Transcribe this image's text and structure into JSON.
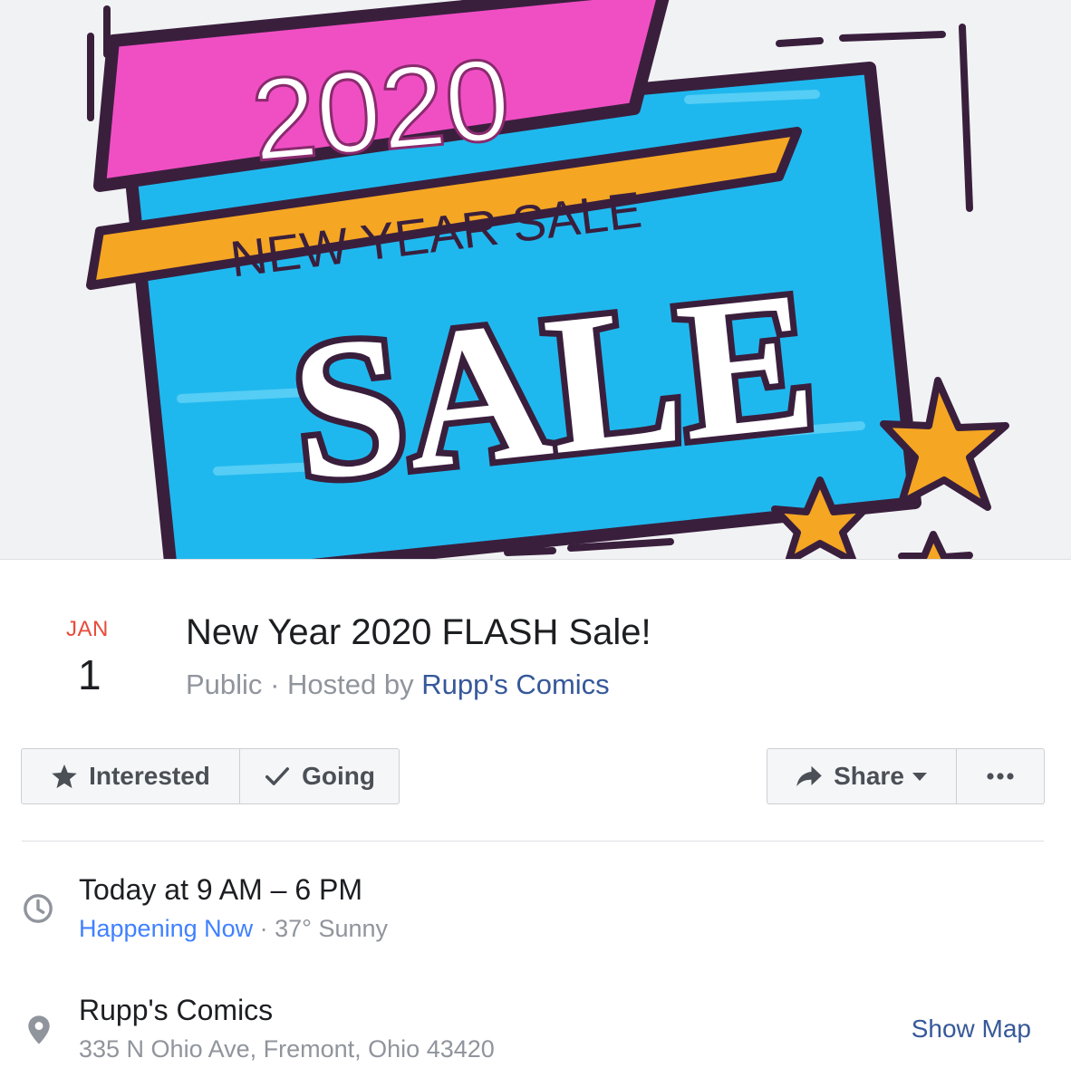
{
  "cover": {
    "year_text": "2020",
    "ribbon_text": "NEW YEAR SALE",
    "sale_text": "SALE",
    "colors": {
      "pink": "#f04fc4",
      "blue": "#1fb8ee",
      "orange": "#f5a623",
      "dark": "#3a1f3d",
      "background": "#f1f2f4"
    }
  },
  "event": {
    "month": "JAN",
    "day": "1",
    "title": "New Year 2020 FLASH Sale!",
    "privacy": "Public",
    "hosted_by_prefix": "Hosted by",
    "host_name": "Rupp's Comics"
  },
  "actions": {
    "interested_label": "Interested",
    "interested_icon": "star-icon",
    "going_label": "Going",
    "going_icon": "check-icon",
    "share_label": "Share",
    "share_icon": "share-arrow-icon",
    "more_icon": "more-dots-icon"
  },
  "details": {
    "time": {
      "icon": "clock-icon",
      "when": "Today at 9 AM – 6 PM",
      "status": "Happening Now",
      "weather": "37° Sunny"
    },
    "location": {
      "icon": "map-pin-icon",
      "name": "Rupp's Comics",
      "address": "335 N Ohio Ave, Fremont, Ohio 43420",
      "show_map_label": "Show Map"
    }
  },
  "colors": {
    "date_red": "#e84b3c",
    "link_blue": "#365899",
    "happening_blue": "#4080ff",
    "muted_gray": "#90949c"
  }
}
